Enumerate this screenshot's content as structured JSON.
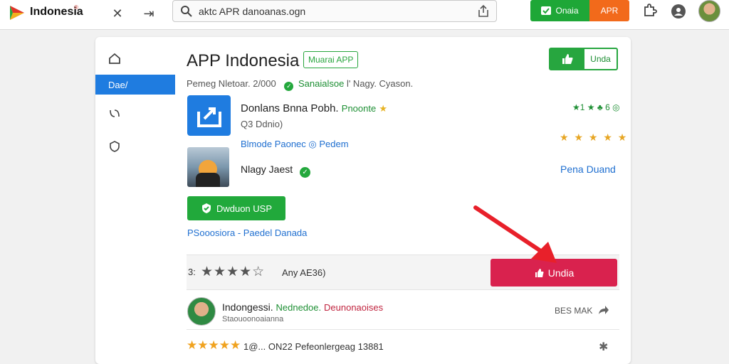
{
  "topbar": {
    "brand": "Indonesia",
    "brand_mark": "®",
    "search_text": "aktc APR danoanas.ogn",
    "green_label": "Onaia",
    "orange_label": "APR"
  },
  "sidebar": {
    "items": [
      {
        "label": ""
      },
      {
        "label": "Dae/"
      },
      {
        "label": ""
      },
      {
        "label": ""
      }
    ]
  },
  "header": {
    "title": "APP Indonesia",
    "badge": "Muarai APP",
    "meta_prefix": "Pemeg Nletoar. 2/000",
    "meta_green": "Sanaialsoe",
    "meta_suffix": "l' Nagy. Cyason.",
    "toggle_right": "Unda"
  },
  "app1": {
    "name": "Donlans Bnna Pobh.",
    "tag": "Pnoonte",
    "sub": "Q3 Ddnio)",
    "rate_a": "★1 ★ ♣ 6 ◎",
    "rate_b": "★ ★ ★ ★ ★"
  },
  "links": {
    "row_link": "Blmode Paonec",
    "row_link2": "Pedem",
    "row_name": "Nlagy Jaest",
    "right_link": "Pena Duand",
    "dl_button": "Dwduon USP",
    "promo_link": "PSooosiora - Paedel Danada"
  },
  "rating": {
    "count": "3:",
    "stars": "★★★★☆",
    "text": "Any AE36)",
    "button": "Undia"
  },
  "review": {
    "name": "Indongessi.",
    "green": "Nednedoe.",
    "red": "Deunonaoises",
    "sub": "Staouoonoaianna",
    "action": "BES MAK"
  },
  "footer": {
    "stars": "★★★★★",
    "text": "1@... ON22 Pefeonlergeag 13881"
  },
  "colors": {
    "accent_blue": "#1f7ce0",
    "green": "#21a93b",
    "orange": "#f26a1b",
    "red": "#d9224e"
  }
}
